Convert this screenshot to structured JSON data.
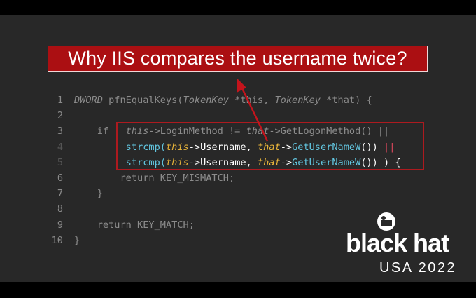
{
  "title": "Why IIS compares the username twice?",
  "code_lines": [
    {
      "num": "1",
      "indent": "",
      "parts": [
        {
          "t": "DWORD ",
          "cls": "it"
        },
        {
          "t": "pfnEqualKeys(",
          "cls": ""
        },
        {
          "t": "TokenKey",
          "cls": "it"
        },
        {
          "t": " *this, ",
          "cls": ""
        },
        {
          "t": "TokenKey",
          "cls": "it"
        },
        {
          "t": " *that) {",
          "cls": ""
        }
      ]
    },
    {
      "num": "2",
      "indent": "",
      "parts": []
    },
    {
      "num": "3",
      "indent": "    ",
      "parts": [
        {
          "t": "if ( ",
          "cls": ""
        },
        {
          "t": "this",
          "cls": "it"
        },
        {
          "t": "->LoginMethod != ",
          "cls": ""
        },
        {
          "t": "that",
          "cls": "it"
        },
        {
          "t": "->GetLogonMethod() ||",
          "cls": ""
        }
      ]
    },
    {
      "num": "4",
      "indent": "         ",
      "parts": [
        {
          "t": "strcmp(",
          "cls": "c"
        },
        {
          "t": "this",
          "cls": "y"
        },
        {
          "t": "->Username, ",
          "cls": "b"
        },
        {
          "t": "that",
          "cls": "y"
        },
        {
          "t": "->",
          "cls": "b"
        },
        {
          "t": "GetUserNameW",
          "cls": "c"
        },
        {
          "t": "()) ",
          "cls": "b"
        },
        {
          "t": "||",
          "cls": "r"
        }
      ]
    },
    {
      "num": "5",
      "indent": "         ",
      "parts": [
        {
          "t": "strcmp(",
          "cls": "c"
        },
        {
          "t": "this",
          "cls": "y"
        },
        {
          "t": "->Username, ",
          "cls": "b"
        },
        {
          "t": "that",
          "cls": "y"
        },
        {
          "t": "->",
          "cls": "b"
        },
        {
          "t": "GetUserNameW",
          "cls": "c"
        },
        {
          "t": "()) ) {",
          "cls": "b"
        }
      ]
    },
    {
      "num": "6",
      "indent": "        ",
      "parts": [
        {
          "t": "return KEY_MISMATCH;",
          "cls": ""
        }
      ]
    },
    {
      "num": "7",
      "indent": "    ",
      "parts": [
        {
          "t": "}",
          "cls": ""
        }
      ]
    },
    {
      "num": "8",
      "indent": "",
      "parts": []
    },
    {
      "num": "9",
      "indent": "    ",
      "parts": [
        {
          "t": "return KEY_MATCH;",
          "cls": ""
        }
      ]
    },
    {
      "num": "10",
      "indent": "",
      "parts": [
        {
          "t": "}",
          "cls": ""
        }
      ]
    }
  ],
  "logo": {
    "name": "black hat",
    "subtitle": "USA 2022"
  },
  "colors": {
    "title_bg": "#ab0f12",
    "highlight": "#ad1a1f",
    "slide_bg": "#282828"
  }
}
